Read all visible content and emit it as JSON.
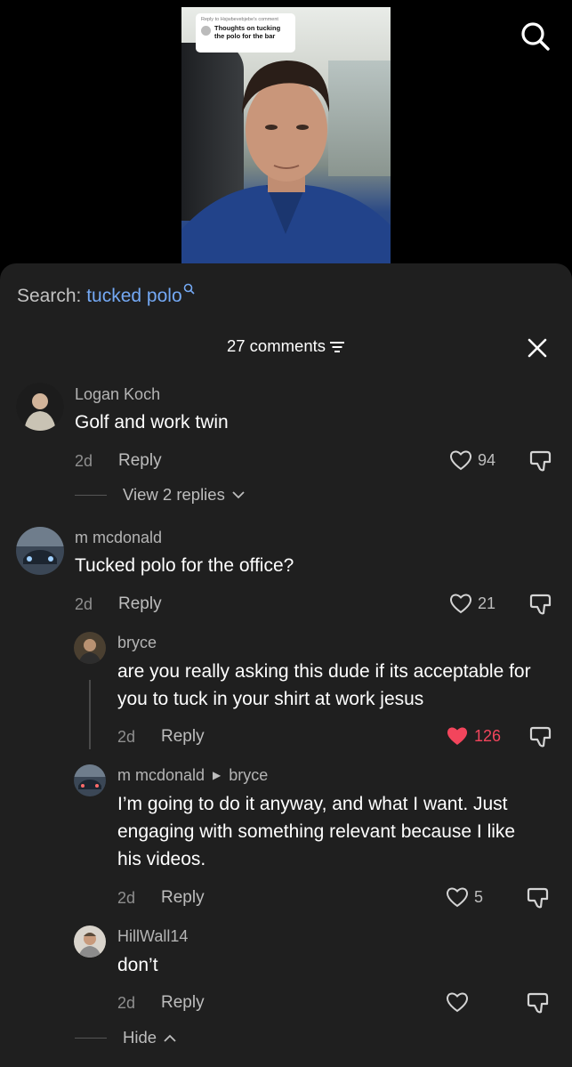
{
  "video": {
    "sticker_small": "Reply to Hsjwbevebjebe's comment",
    "sticker_text": "Thoughts on tucking the polo for the bar"
  },
  "icons": {
    "search": "search-icon",
    "filter": "filter-icon",
    "close": "close-icon",
    "heart": "heart-icon",
    "dislike": "dislike-icon",
    "chevron": "chevron-icon"
  },
  "colors": {
    "accent": "#74a9f4",
    "liked": "#f2455c",
    "sheet": "#1f1f1f"
  },
  "search": {
    "prefix": "Search:",
    "keyword": "tucked polo"
  },
  "header": {
    "count_label": "27 comments"
  },
  "comments": [
    {
      "user": "Logan Koch",
      "text": "Golf and work twin",
      "time": "2d",
      "reply_label": "Reply",
      "likes": "94",
      "view_replies": "View 2 replies"
    },
    {
      "user": "m mcdonald",
      "text": "Tucked polo for the office?",
      "time": "2d",
      "reply_label": "Reply",
      "likes": "21",
      "replies": [
        {
          "user": "bryce",
          "text": "are you really asking this dude if its acceptable for you to tuck in your shirt at work jesus",
          "time": "2d",
          "reply_label": "Reply",
          "likes": "126",
          "liked": true
        },
        {
          "user": "m mcdonald",
          "reply_to": "bryce",
          "text": "I’m going to do it anyway, and what I want. Just engaging with something relevant because I like his videos.",
          "time": "2d",
          "reply_label": "Reply",
          "likes": "5"
        },
        {
          "user": "HillWall14",
          "text": "don’t",
          "time": "2d",
          "reply_label": "Reply",
          "likes": ""
        }
      ],
      "hide_label": "Hide"
    }
  ]
}
